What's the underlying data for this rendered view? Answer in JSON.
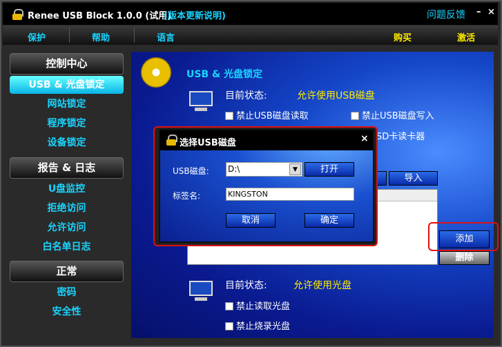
{
  "window": {
    "title": "Renee USB Block 1.0.0 (试用)",
    "update_link": "(版本更新说明)",
    "feedback": "问题反馈",
    "minimize": "–",
    "close": "×"
  },
  "menu": {
    "items": [
      "保护",
      "帮助",
      "语言"
    ],
    "buy": "购买",
    "activate": "激活"
  },
  "sidebar": {
    "sections": [
      {
        "header": "控制中心",
        "items": [
          "USB & 光盘锁定",
          "网站锁定",
          "程序锁定",
          "设备锁定"
        ]
      },
      {
        "header": "报告 & 日志",
        "items": [
          "U盘监控",
          "拒绝访问",
          "允许访问",
          "白名单日志"
        ]
      },
      {
        "header": "正常",
        "items": [
          "密码",
          "安全性"
        ]
      }
    ],
    "selected": "USB & 光盘锁定"
  },
  "main": {
    "title": "USB & 光盘锁定",
    "usb": {
      "status_label": "目前状态:",
      "status_value": "允许使用USB磁盘",
      "opt_read": "禁止USB磁盘读取",
      "opt_write": "禁止USB磁盘写入",
      "opt_sd": "SD卡读卡器",
      "import": "导入",
      "add": "添加",
      "delete": "删除"
    },
    "cd": {
      "status_label": "目前状态:",
      "status_value": "允许使用光盘",
      "opt_read": "禁止读取光盘",
      "opt_burn": "禁止烧录光盘"
    }
  },
  "dialog": {
    "title": "选择USB磁盘",
    "close": "×",
    "usb_label": "USB磁盘:",
    "usb_value": "D:\\",
    "open": "打开",
    "tag_label": "标签名:",
    "tag_value": "KINGSTON",
    "cancel": "取消",
    "ok": "确定"
  },
  "colors": {
    "accent": "#19d4ff",
    "yellow": "#ffea00",
    "highlight": "#e01010"
  }
}
